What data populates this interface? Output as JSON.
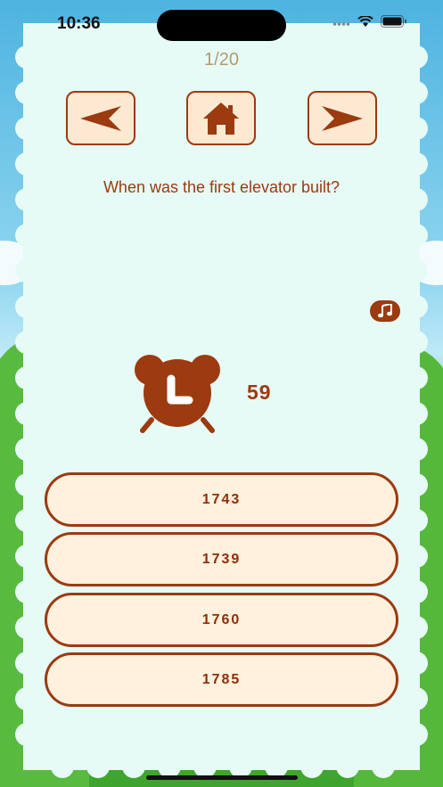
{
  "status": {
    "time": "10:36",
    "icons": [
      "signal-icon",
      "wifi-icon",
      "battery-icon"
    ]
  },
  "quiz": {
    "counter": "1/20",
    "nav": {
      "prev_icon": "arrow-left-icon",
      "home_icon": "home-icon",
      "next_icon": "arrow-right-icon"
    },
    "question": "When was the first elevator built?",
    "timer": {
      "icon": "alarm-clock-icon",
      "seconds": "59"
    },
    "music_icon": "music-note-icon",
    "answers": [
      "1743",
      "1739",
      "1760",
      "1785"
    ]
  },
  "colors": {
    "accent": "#9c3a10",
    "button_fill": "#fff1dd",
    "card": "#e6fbf6",
    "counter": "#b59a6a"
  }
}
